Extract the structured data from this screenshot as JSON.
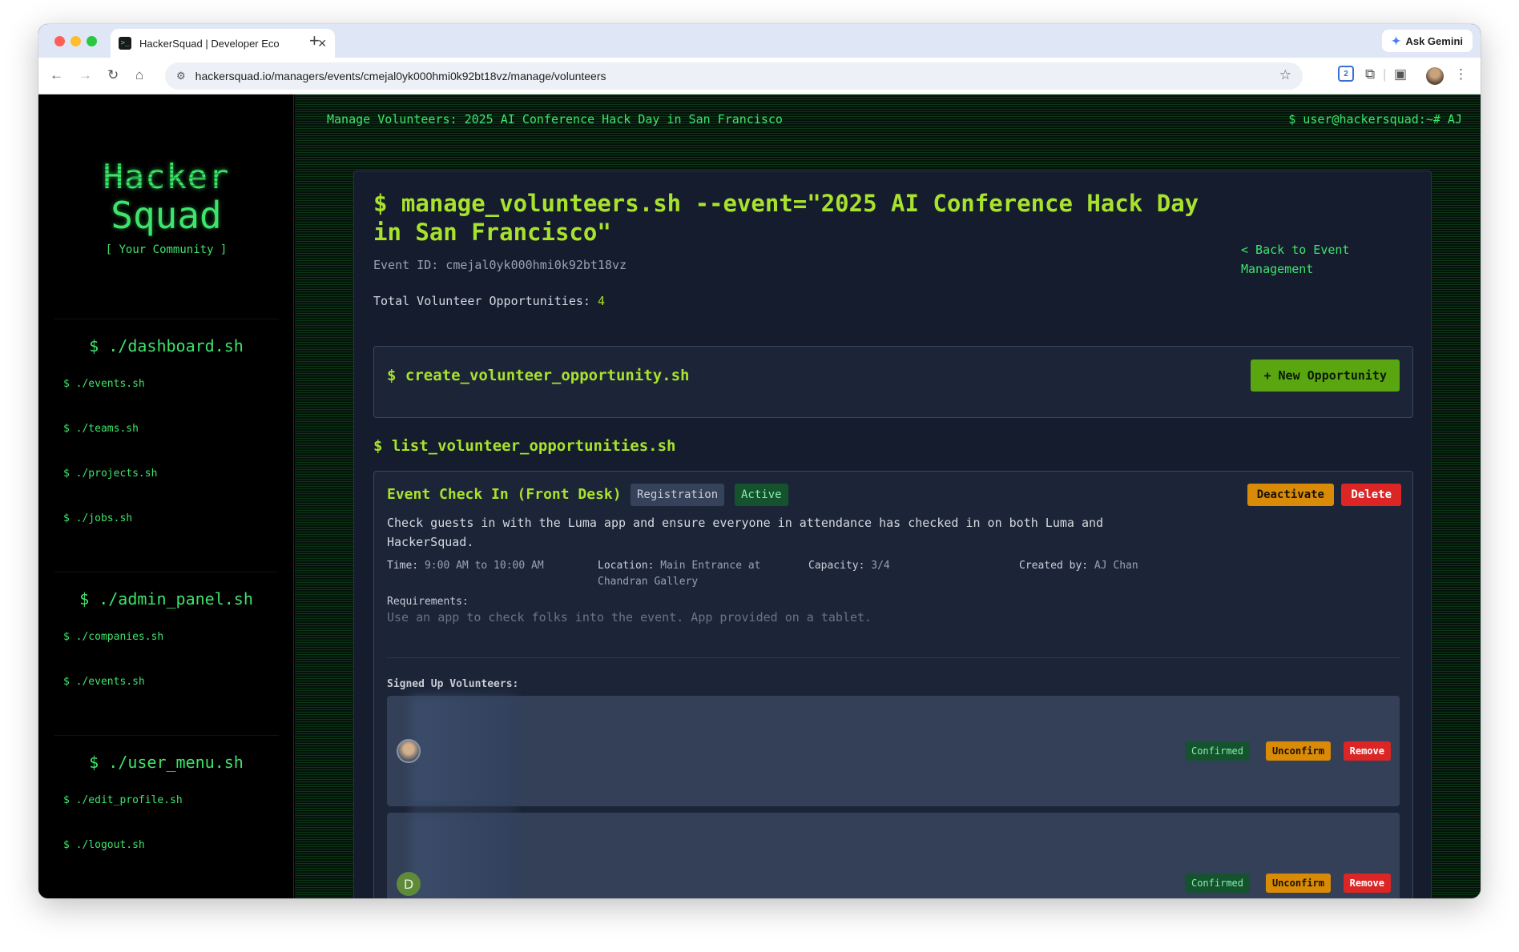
{
  "browser": {
    "tab_title": "HackerSquad | Developer Eco",
    "tab_favicon": ">_",
    "new_tab": "+",
    "tab_close": "✕",
    "ask_gemini": "Ask Gemini",
    "url": "hackersquad.io/managers/events/cmejal0yk000hmi0k92bt18vz/manage/volunteers",
    "extension_badge": "2"
  },
  "sidebar": {
    "logo_line1": "Hacker",
    "logo_line2": "Squad",
    "tagline": "[ Your Community ]",
    "sections": [
      {
        "header": "$ ./dashboard.sh",
        "links": [
          "$ ./events.sh",
          "$ ./teams.sh",
          "$ ./projects.sh",
          "$ ./jobs.sh"
        ]
      },
      {
        "header": "$ ./admin_panel.sh",
        "links": [
          "$ ./companies.sh",
          "$ ./events.sh"
        ]
      },
      {
        "header": "$ ./user_menu.sh",
        "links": [
          "$ ./edit_profile.sh",
          "$ ./logout.sh"
        ]
      }
    ]
  },
  "topbar": {
    "left": "Manage Volunteers: 2025 AI Conference Hack Day in San Francisco",
    "right": "$ user@hackersquad:~# AJ"
  },
  "main": {
    "title": "$ manage_volunteers.sh --event=\"2025 AI Conference Hack Day in San Francisco\"",
    "back_link": "< Back to Event Management",
    "event_id": "Event ID: cmejal0yk000hmi0k92bt18vz",
    "total_label": "Total Volunteer Opportunities:",
    "total_value": "4",
    "create_title": "$ create_volunteer_opportunity.sh",
    "new_opportunity": "+ New Opportunity",
    "list_title": "$ list_volunteer_opportunities.sh"
  },
  "opportunity": {
    "title": "Event Check In (Front Desk)",
    "category": "Registration",
    "status": "Active",
    "deactivate": "Deactivate",
    "delete": "Delete",
    "description": "Check guests in with the Luma app and ensure everyone in attendance has checked in on both Luma and HackerSquad.",
    "time_label": "Time:",
    "time_value": "9:00 AM to 10:00 AM",
    "location_label": "Location:",
    "location_value": "Main Entrance at Chandran Gallery",
    "capacity_label": "Capacity:",
    "capacity_value": "3/4",
    "created_label": "Created by:",
    "created_value": "AJ Chan",
    "requirements_label": "Requirements:",
    "requirements_text": "Use an app to check folks into the event. App provided on a tablet.",
    "signed_up_label": "Signed Up Volunteers:",
    "volunteers": [
      {
        "avatar": "",
        "status": "Confirmed",
        "unconfirm": "Unconfirm",
        "remove": "Remove"
      },
      {
        "avatar": "D",
        "status": "Confirmed",
        "unconfirm": "Unconfirm",
        "remove": "Remove"
      }
    ]
  }
}
